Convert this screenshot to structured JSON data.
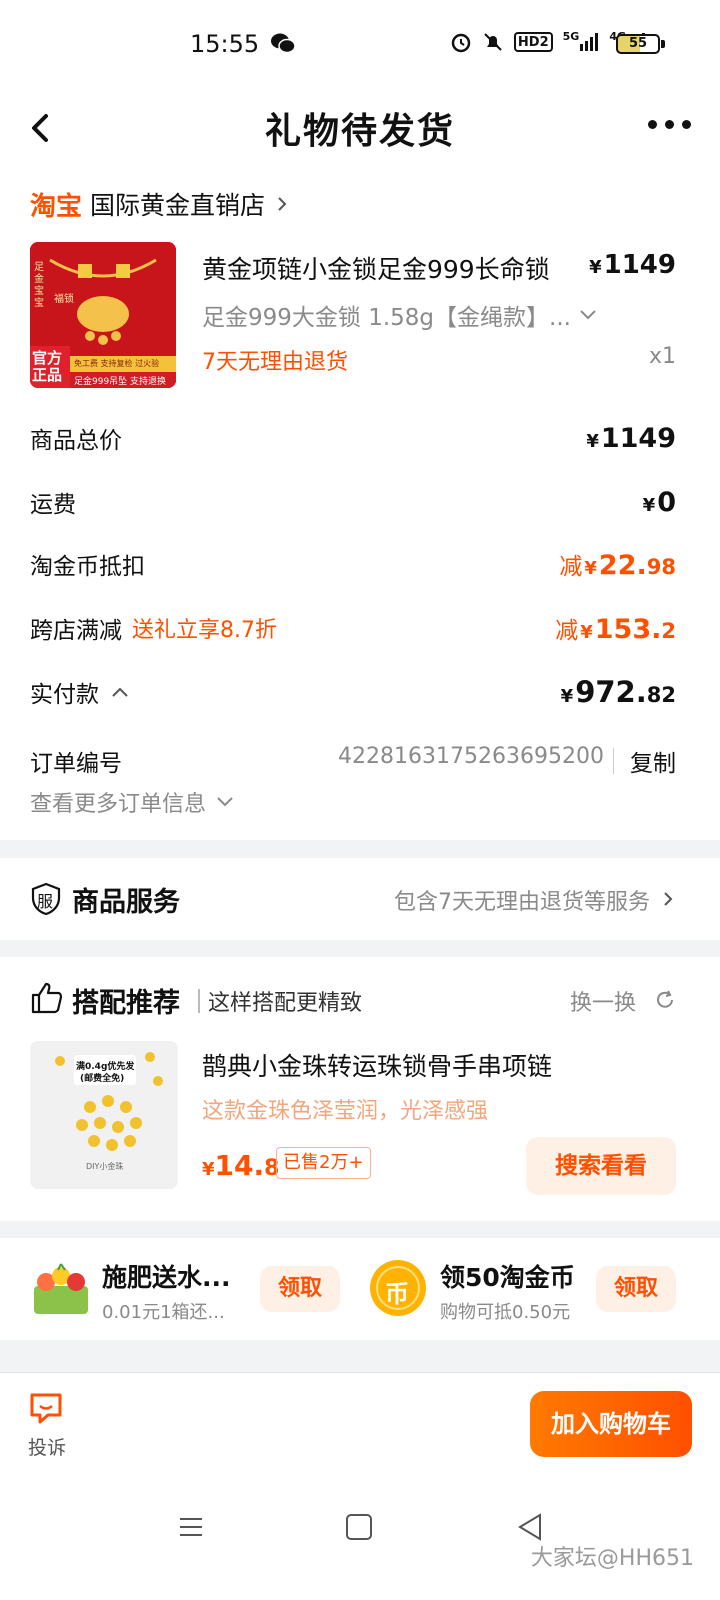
{
  "status": {
    "time": "15:55",
    "battery": "55",
    "network1": "5G",
    "network2": "4G",
    "hd": "HD2"
  },
  "nav": {
    "title": "礼物待发货"
  },
  "shop": {
    "logo": "淘宝",
    "name": "国际黄金直销店"
  },
  "product": {
    "image_text_1": "足金宝宝",
    "image_text_2": "福锁",
    "image_badge": "官方正品",
    "image_banner_1": "免工费 支持复检 过火验",
    "image_banner_2": "足金999吊坠 支持退换",
    "title": "黄金项链小金锁足金999长命锁",
    "price_symbol": "¥",
    "price": "1149",
    "sku": "足金999大金锁 1.58g【金绳款】...",
    "return_policy": "7天无理由退货",
    "qty": "x1"
  },
  "fees": {
    "goods_total_label": "商品总价",
    "goods_total_symbol": "¥",
    "goods_total": "1149",
    "shipping_label": "运费",
    "shipping_symbol": "¥",
    "shipping": "0",
    "coin_label": "淘金币抵扣",
    "coin_prefix": "减",
    "coin_symbol": "¥",
    "coin_int": "22.",
    "coin_dec": "98",
    "cross_label": "跨店满减",
    "cross_promo": "送礼立享8.7折",
    "cross_prefix": "减",
    "cross_symbol": "¥",
    "cross_int": "153.",
    "cross_dec": "2",
    "paid_label": "实付款",
    "paid_symbol": "¥",
    "paid_int": "972.",
    "paid_dec": "82"
  },
  "order": {
    "number_label": "订单编号",
    "number": "4228163175263695200",
    "copy": "复制",
    "more_info": "查看更多订单信息"
  },
  "service": {
    "icon_char": "服",
    "title": "商品服务",
    "desc": "包含7天无理由退货等服务"
  },
  "recommend": {
    "title": "搭配推荐",
    "subtitle": "这样搭配更精致",
    "swap": "换一换",
    "image_text_1": "满0.4g优先发",
    "image_text_2": "(邮费全免)",
    "image_caption": "DIY小金珠",
    "item_name": "鹊典小金珠转运珠锁骨手串项链",
    "item_desc": "这款金珠色泽莹润，光泽感强",
    "price_symbol": "¥",
    "price_int": "14.",
    "price_dec": "8",
    "sold": "已售2万+",
    "button": "搜索看看"
  },
  "promos": [
    {
      "title": "施肥送水...",
      "sub": "0.01元1箱还...",
      "button": "领取"
    },
    {
      "coin_char": "币",
      "title": "领50淘金币",
      "sub": "购物可抵0.50元",
      "button": "领取"
    }
  ],
  "bottom": {
    "complain": "投诉",
    "add_cart": "加入购物车"
  },
  "watermark": "大家坛@HH651",
  "colors": {
    "accent": "#ff5000",
    "background": "#f2f3f5",
    "card": "#ffffff"
  }
}
